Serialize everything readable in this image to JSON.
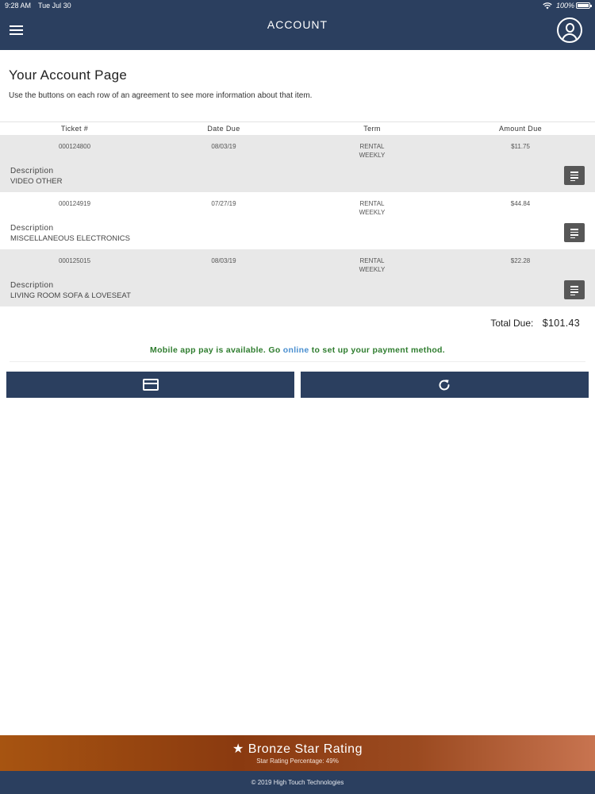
{
  "status_bar": {
    "time": "9:28 AM",
    "date": "Tue Jul 30",
    "battery": "100%"
  },
  "nav": {
    "title": "ACCOUNT",
    "menu_icon": "hamburger-menu-icon",
    "profile_icon": "user-profile-icon"
  },
  "page": {
    "title": "Your Account Page",
    "instructions": "Use the buttons on each row of an agreement to see more information about that item."
  },
  "table": {
    "headers": [
      "Ticket #",
      "Date Due",
      "Term",
      "Amount Due"
    ],
    "description_label": "Description",
    "rows": [
      {
        "ticket": "000124800",
        "date_due": "08/03/19",
        "term_line1": "RENTAL",
        "term_line2": "WEEKLY",
        "amount": "$11.75",
        "description": "VIDEO OTHER"
      },
      {
        "ticket": "000124919",
        "date_due": "07/27/19",
        "term_line1": "RENTAL",
        "term_line2": "WEEKLY",
        "amount": "$44.84",
        "description": "MISCELLANEOUS ELECTRONICS"
      },
      {
        "ticket": "000125015",
        "date_due": "08/03/19",
        "term_line1": "RENTAL",
        "term_line2": "WEEKLY",
        "amount": "$22.28",
        "description": "LIVING ROOM SOFA & LOVESEAT"
      }
    ]
  },
  "totals": {
    "label": "Total Due:",
    "amount": "$101.43"
  },
  "payment_message": {
    "before": "Mobile app pay is available. Go ",
    "link": "online",
    "after": " to set up your payment method."
  },
  "actions": {
    "left_icon": "credit-card-icon",
    "right_icon": "refresh-icon"
  },
  "rating": {
    "title": "Bronze Star Rating",
    "star": "★",
    "subtitle": "Star Rating Percentage: 49%"
  },
  "footer": {
    "text": "© 2019 High Touch Technologies"
  },
  "colors": {
    "navy": "#2b3f5f",
    "row_gray": "#e8e8e8",
    "detail_button": "#575757",
    "pay_message_green": "#2f7d2f",
    "link_blue": "#4a8fd0",
    "bronze": "#a75411"
  }
}
